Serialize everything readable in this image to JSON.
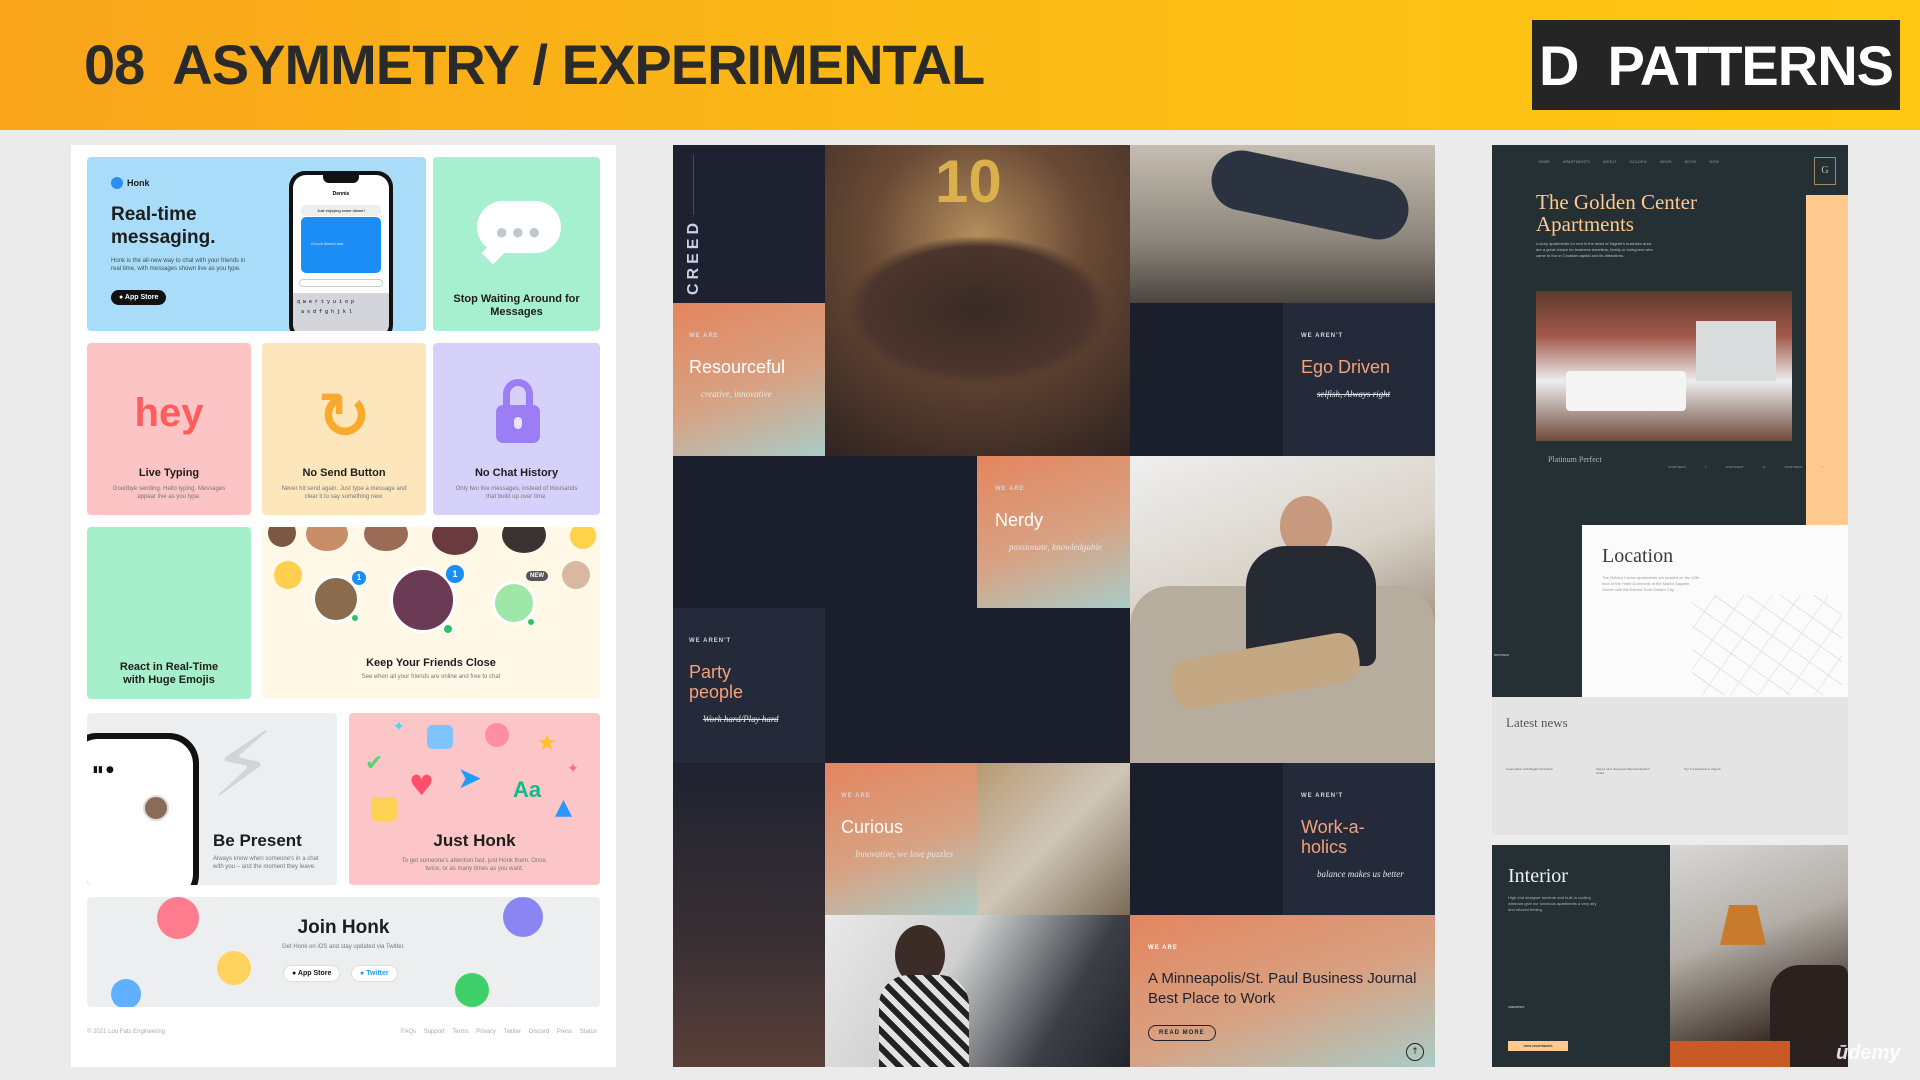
{
  "header": {
    "number": "08",
    "title": "ASYMMETRY / EXPERIMENTAL",
    "badge": "D  PATTERNS",
    "colors": {
      "start": "#f8a51a",
      "end": "#fec812",
      "badge": "#252525"
    }
  },
  "honk": {
    "brand": "Honk",
    "hero_title": "Real-time messaging.",
    "hero_desc": "Honk is the all-new way to chat with your friends in real time, with messages shown live as you type.",
    "app_store": "App Store",
    "phone_header": "Dennis",
    "phone_bubble": "Just enjoying some dinner!",
    "phone_input": "Ooooh kimchi and",
    "keyboard_rows": [
      "qwertyuiop",
      "asdfghjkl"
    ],
    "waiting_title": "Stop Waiting Around for Messages",
    "hey": "hey",
    "features": [
      {
        "title": "Live Typing",
        "desc": "Goodbye sending. Hello typing. Messages appear live as you type.",
        "color": "#fcc4c4",
        "icon": "hey-text"
      },
      {
        "title": "No Send Button",
        "desc": "Never hit send again. Just type a message and clear it to say something new.",
        "color": "#fde6bb",
        "icon": "refresh-icon"
      },
      {
        "title": "No Chat History",
        "desc": "Only two live messages, instead of thousands that build up over time.",
        "color": "#d6d1fb",
        "icon": "lock-icon"
      }
    ],
    "emoji_title": "React in Real-Time with Huge Emojis",
    "friends_title": "Keep Your Friends Close",
    "friends_desc": "See when all your friends are online and free to chat",
    "new_badge": "NEW",
    "notif_count": "1",
    "present_title": "Be Present",
    "present_desc": "Always know when someone's in a chat with you – and the moment they leave.",
    "junk_title": "Just Honk",
    "junk_desc": "To get someone's attention fast, just Honk them. Once, twice, or as many times as you want.",
    "join_title": "Join Honk",
    "join_desc": "Get Honk on iOS and stay updated via Twitter.",
    "twitter": "Twitter",
    "aa": "Aa",
    "copyright": "© 2021 Lou Fats Engineering",
    "footer_links": [
      "FAQs",
      "Support",
      "Terms",
      "Privacy",
      "Twitter",
      "Discord",
      "Press",
      "Status"
    ]
  },
  "creed": {
    "logo": "CREED",
    "cells": [
      {
        "label": "WE ARE",
        "title": "Resourceful",
        "sub": "creative, innovative"
      },
      {
        "label": "WE AREN'T",
        "title": "Ego Driven",
        "sub": "selfish, Always right"
      },
      {
        "label": "WE ARE",
        "title": "Nerdy",
        "sub": "passionate, knowledgable"
      },
      {
        "label": "WE AREN'T",
        "title": "Party people",
        "sub": "Work hard/Play hard"
      },
      {
        "label": "WE ARE",
        "title": "Curious",
        "sub": "Innovative, we love puzzles"
      },
      {
        "label": "WE AREN'T",
        "title": "Work-a-holics",
        "sub": "balance makes us better"
      },
      {
        "label": "WE ARE",
        "title": "A Minneapolis/St. Paul Business Journal Best Place to Work",
        "sub": "READ MORE"
      }
    ],
    "balloon": "10"
  },
  "golden": {
    "nav": [
      "HOME",
      "APARTMENTS",
      "ABOUT GOLDEN",
      "NEWS",
      "BOOK NOW"
    ],
    "title": "The Golden Center Apartments",
    "intro": "Luxury apartments for rent in the heart of Zagreb's business area are a great choice for business travellers, family or foreigners who came to live in Croatian capital and its attractions.",
    "platinum": "Platinum Perfect",
    "apartments": [
      "APARTMENT",
      "APARTMENT 1",
      "APARTMENT 12",
      "APARTMENT 1"
    ],
    "location_title": "Location",
    "location_desc": "The Golden Center apartments are located on the 10th floor of the Hotel Dubrovnik at the Marko Gagarin Center with the Eleven Gold Golden City.",
    "distance": "DISTANCE",
    "latest_news": "Latest news",
    "news": [
      "Cooperation with Bagatin Polyclinic",
      "Zagreb wins 'European Best Destination' award",
      "Top 5 restaurants in Zagreb"
    ],
    "interior_title": "Interior",
    "interior_desc": "High end designer furniture and built-in cooling windows give our luxurious apartments a very airy and relaxed feeling.",
    "amenities": "AMENITIES",
    "cta": "VIEW APARTMENTS"
  },
  "watermark": "ūdemy"
}
